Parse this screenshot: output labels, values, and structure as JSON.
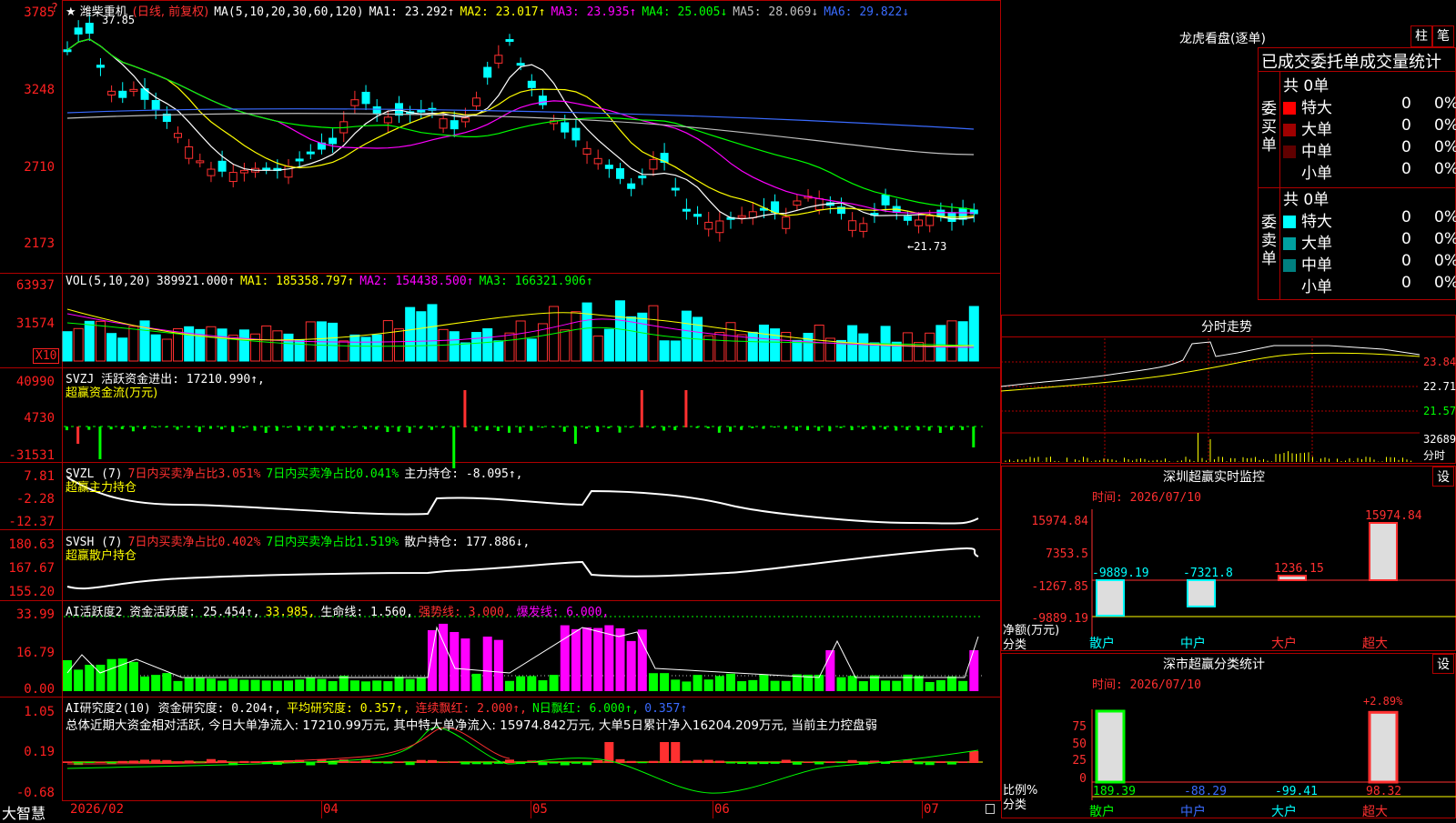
{
  "stock": {
    "title": "★ 潍柴重机",
    "mode": "(日线, 前复权)",
    "ma_label": "MA(5,10,20,30,60,120)",
    "ma_values": [
      {
        "label": "MA1: 23.292↑",
        "color": "#ffffff"
      },
      {
        "label": "MA2: 23.017↑",
        "color": "#ffff00"
      },
      {
        "label": "MA3: 23.935↑",
        "color": "#ff00ff"
      },
      {
        "label": "MA4: 25.005↓",
        "color": "#00ff00"
      },
      {
        "label": "MA5: 28.069↓",
        "color": "#c0c0c0"
      },
      {
        "label": "MA6: 29.822↓",
        "color": "#3a6bff"
      }
    ],
    "high_label": "37.85",
    "low_label": "←21.73",
    "y_ticks": [
      "3785",
      "3248",
      "2710",
      "2173"
    ],
    "question": "?"
  },
  "volume": {
    "header": "VOL(5,10,20)",
    "values": [
      {
        "label": "389921.000↑",
        "color": "#ffffff"
      },
      {
        "label": "MA1: 185358.797↑",
        "color": "#ffff00"
      },
      {
        "label": "MA2: 154438.500↑",
        "color": "#ff00ff"
      },
      {
        "label": "MA3: 166321.906↑",
        "color": "#00ff00"
      }
    ],
    "y_ticks": [
      "63937",
      "31574"
    ],
    "unit": "X10"
  },
  "svzj": {
    "header": "SVZJ  活跃资金进出: 17210.990↑,",
    "subheader": "超赢资金流(万元)",
    "y_ticks": [
      "40990",
      "4730",
      "-31531"
    ]
  },
  "svzl": {
    "header_a": "SVZL (7)",
    "header_b": "7日内买卖净占比3.051%",
    "header_c": "7日内买卖净占比0.041%",
    "header_d": "主力持仓: -8.095↑,",
    "subheader": "超赢主力持仓",
    "y_ticks": [
      "7.81",
      "-2.28",
      "-12.37"
    ]
  },
  "svsh": {
    "header_a": "SVSH (7)",
    "header_b": "7日内买卖净占比0.402%",
    "header_c": "7日内买卖净占比1.519%",
    "header_d": "散户持仓: 177.886↓,",
    "subheader": "超赢散户持仓",
    "y_ticks": [
      "180.63",
      "167.67",
      "155.20"
    ]
  },
  "ai_active": {
    "header_a": "AI活跃度2 资金活跃度: 25.454↑,",
    "header_b": "33.985,",
    "header_c": "生命线: 1.560,",
    "header_d": "强势线: 3.000,",
    "header_e": "爆发线: 6.000,",
    "y_ticks": [
      "33.99",
      "16.79",
      "0.00"
    ]
  },
  "ai_research": {
    "header_a": "AI研究度2(10) 资金研究度: 0.204↑,",
    "header_b": "平均研究度: 0.357↑,",
    "header_c": "连续飘红: 2.000↑,",
    "header_d": "N日飘红: 6.000↑,",
    "header_e": "0.357↑",
    "summary": "总体近期大资金相对活跃, 今日大单净流入: 17210.99万元, 其中特大单净流入: 15974.842万元, 大单5日累计净入16204.209万元, 当前主力控盘弱",
    "y_ticks": [
      "1.05",
      "0.19",
      "-0.68"
    ]
  },
  "xaxis": {
    "brand": "大智慧",
    "labels": [
      "2026/02",
      "04",
      "05",
      "06",
      "07"
    ]
  },
  "right": {
    "lhb_title": "龙虎看盘(逐单)",
    "btn_zhu": "柱",
    "btn_bi": "笔",
    "order_title": "已成交委托单成交量统计",
    "buy_label": "委买单",
    "sell_label": "委卖单",
    "buy_total": "共 0单",
    "sell_total": "共 0单",
    "buy_rows": [
      {
        "name": "特大",
        "color": "#ff0000",
        "count": "0",
        "pct": "0%"
      },
      {
        "name": "大单",
        "color": "#a00000",
        "count": "0",
        "pct": "0%"
      },
      {
        "name": "中单",
        "color": "#600000",
        "count": "0",
        "pct": "0%"
      },
      {
        "name": "小单",
        "color": "#000000",
        "count": "0",
        "pct": "0%"
      }
    ],
    "sell_rows": [
      {
        "name": "特大",
        "color": "#00ffff",
        "count": "0",
        "pct": "0%"
      },
      {
        "name": "大单",
        "color": "#00a0a0",
        "count": "0",
        "pct": "0%"
      },
      {
        "name": "中单",
        "color": "#008080",
        "count": "0",
        "pct": "0%"
      },
      {
        "name": "小单",
        "color": "#000000",
        "count": "0",
        "pct": "0%"
      }
    ],
    "fenshi_title": "分时走势",
    "fenshi_ticks": [
      "23.84",
      "22.71",
      "21.57"
    ],
    "fenshi_vol": "32689",
    "fenshi_label": "分时",
    "monitor_title": "深圳超赢实时监控",
    "monitor_btn": "设",
    "monitor_time": "时间: 2026/07/10",
    "monitor_ticks": [
      "15974.84",
      "7353.5",
      "-1267.85",
      "-9889.19"
    ],
    "monitor_bars": [
      {
        "cat": "散户",
        "value": -9889.19,
        "label": "-9889.19"
      },
      {
        "cat": "中户",
        "value": -7321.8,
        "label": "-7321.8"
      },
      {
        "cat": "大户",
        "value": 1236.15,
        "label": "1236.15"
      },
      {
        "cat": "超大",
        "value": 15974.84,
        "label": "15974.84"
      }
    ],
    "monitor_axis_label": "净额(万元)",
    "monitor_cat_label": "分类",
    "stats_title": "深市超赢分类统计",
    "stats_btn": "设",
    "stats_time": "时间: 2026/07/10",
    "stats_ticks": [
      "75",
      "50",
      "25",
      "0"
    ],
    "stats_extra": "+2.89%",
    "stats_bars": [
      {
        "cat": "散户",
        "value": 189.39,
        "label": "189.39",
        "color": "#00ff00"
      },
      {
        "cat": "中户",
        "value": -88.29,
        "label": "-88.29",
        "color": "#3a6bff"
      },
      {
        "cat": "大户",
        "value": -99.41,
        "label": "-99.41",
        "color": "#00ffff"
      },
      {
        "cat": "超大",
        "value": 98.32,
        "label": "98.32",
        "color": "#ff3030"
      }
    ],
    "stats_axis_label": "比例%",
    "stats_cat_label": "分类"
  }
}
